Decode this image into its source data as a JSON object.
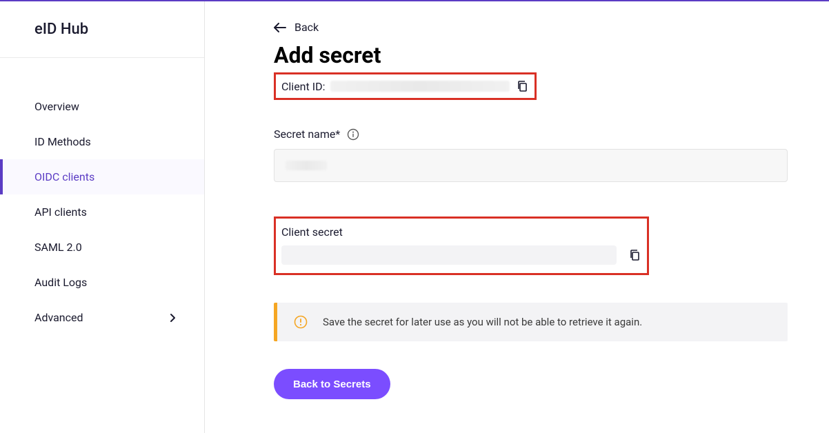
{
  "app": {
    "title": "eID Hub"
  },
  "sidebar": {
    "items": [
      {
        "label": "Overview"
      },
      {
        "label": "ID Methods"
      },
      {
        "label": "OIDC clients"
      },
      {
        "label": "API clients"
      },
      {
        "label": "SAML 2.0"
      },
      {
        "label": "Audit Logs"
      },
      {
        "label": "Advanced"
      }
    ]
  },
  "back": {
    "label": "Back"
  },
  "page": {
    "title": "Add secret"
  },
  "clientId": {
    "label": "Client ID:"
  },
  "secretName": {
    "label": "Secret name*"
  },
  "clientSecret": {
    "label": "Client secret"
  },
  "alert": {
    "text": "Save the secret for later use as you will not be able to retrieve it again."
  },
  "buttons": {
    "backToSecrets": "Back to Secrets"
  }
}
